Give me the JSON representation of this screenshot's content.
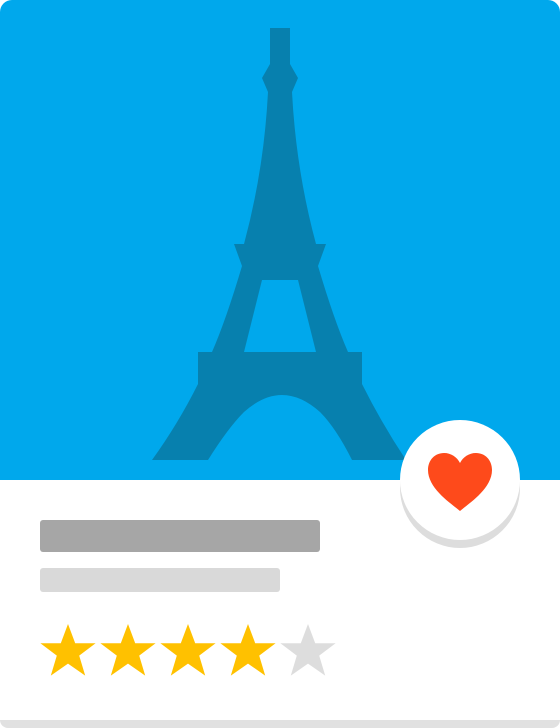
{
  "card": {
    "landmark_icon": "eiffel-tower-icon",
    "hero_color": "#00a8ec",
    "landmark_color": "#0780ae",
    "favorite": {
      "icon": "heart-icon",
      "color": "#fe4a1b",
      "active": true
    },
    "rating": {
      "value": 4,
      "max": 5,
      "filled_color": "#ffc100",
      "empty_color": "#dddddd"
    }
  }
}
